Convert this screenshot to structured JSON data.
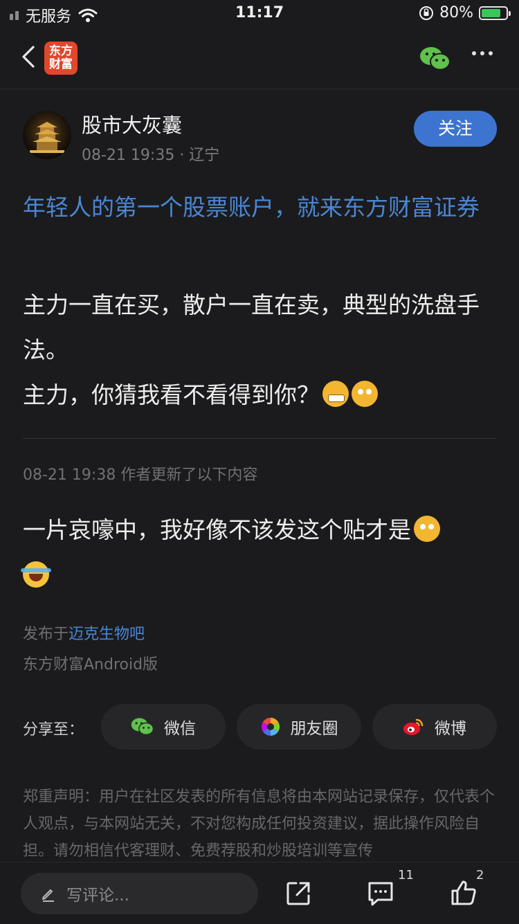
{
  "status_bar": {
    "carrier": "无服务",
    "time": "11:17",
    "battery_pct": "80%"
  },
  "nav": {
    "logo_line1": "东方",
    "logo_line2": "财富"
  },
  "author": {
    "name": "股市大灰囊",
    "meta": "08-21 19:35 · 辽宁",
    "follow_label": "关注"
  },
  "post": {
    "promo_link": "年轻人的第一个股票账户，就来东方财富证券",
    "line1": "主力一直在买，散户一直在卖，典型的洗盘手法。",
    "line2": "主力，你猜我看不看得到你？"
  },
  "update": {
    "meta": "08-21 19:38  作者更新了以下内容",
    "text": "一片哀嚎中，我好像不该发这个贴才是"
  },
  "footer_info": {
    "posted_prefix": "发布于",
    "posted_link": "迈克生物吧",
    "client": "东方财富Android版"
  },
  "share": {
    "label": "分享至：",
    "wechat": "微信",
    "moments": "朋友圈",
    "weibo": "微博"
  },
  "disclaimer": "郑重声明：用户在社区发表的所有信息将由本网站记录保存，仅代表个人观点，与本网站无关，不对您构成任何投资建议，据此操作风险自担。请勿相信代客理财、免费荐股和炒股培训等宣传",
  "bottom_bar": {
    "comment_placeholder": "写评论...",
    "comment_count": "11",
    "like_count": "2"
  },
  "colors": {
    "background": "#1b1b1d",
    "accent_blue": "#3d74cf",
    "link_blue": "#4a86d6",
    "logo_red": "#e2462d"
  }
}
